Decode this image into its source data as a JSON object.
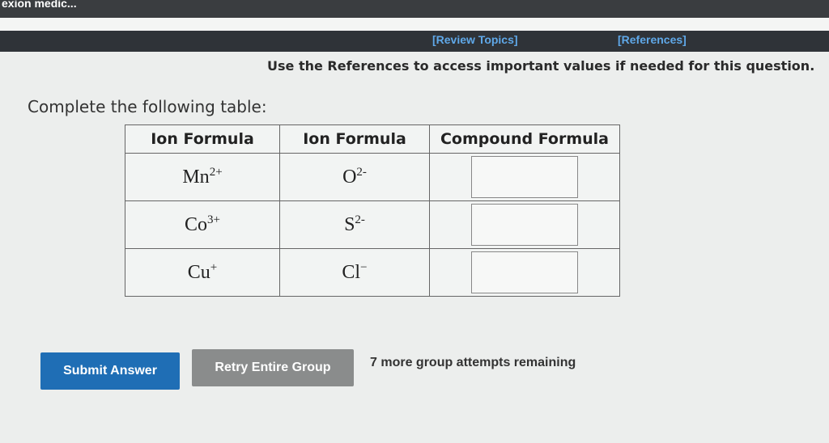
{
  "app": {
    "window_title": "exion medic..."
  },
  "header": {
    "review_topics": "[Review Topics]",
    "references": "[References]"
  },
  "instructions": "Use the References to access important values if needed for this question.",
  "prompt": "Complete the following table:",
  "table": {
    "headers": [
      "Ion Formula",
      "Ion Formula",
      "Compound Formula"
    ],
    "rows": [
      {
        "cation_base": "Mn",
        "cation_charge": "2+",
        "anion_base": "O",
        "anion_charge": "2-",
        "answer": ""
      },
      {
        "cation_base": "Co",
        "cation_charge": "3+",
        "anion_base": "S",
        "anion_charge": "2-",
        "answer": ""
      },
      {
        "cation_base": "Cu",
        "cation_charge": "+",
        "anion_base": "Cl",
        "anion_charge": "−",
        "answer": ""
      }
    ]
  },
  "buttons": {
    "submit": "Submit Answer",
    "retry": "Retry Entire Group"
  },
  "attempts_text": "7 more group attempts remaining",
  "colors": {
    "submit_bg": "#1f6eb5",
    "retry_bg": "#8a8c8c",
    "link": "#5fa8e8",
    "header_bar": "#2f3338"
  }
}
